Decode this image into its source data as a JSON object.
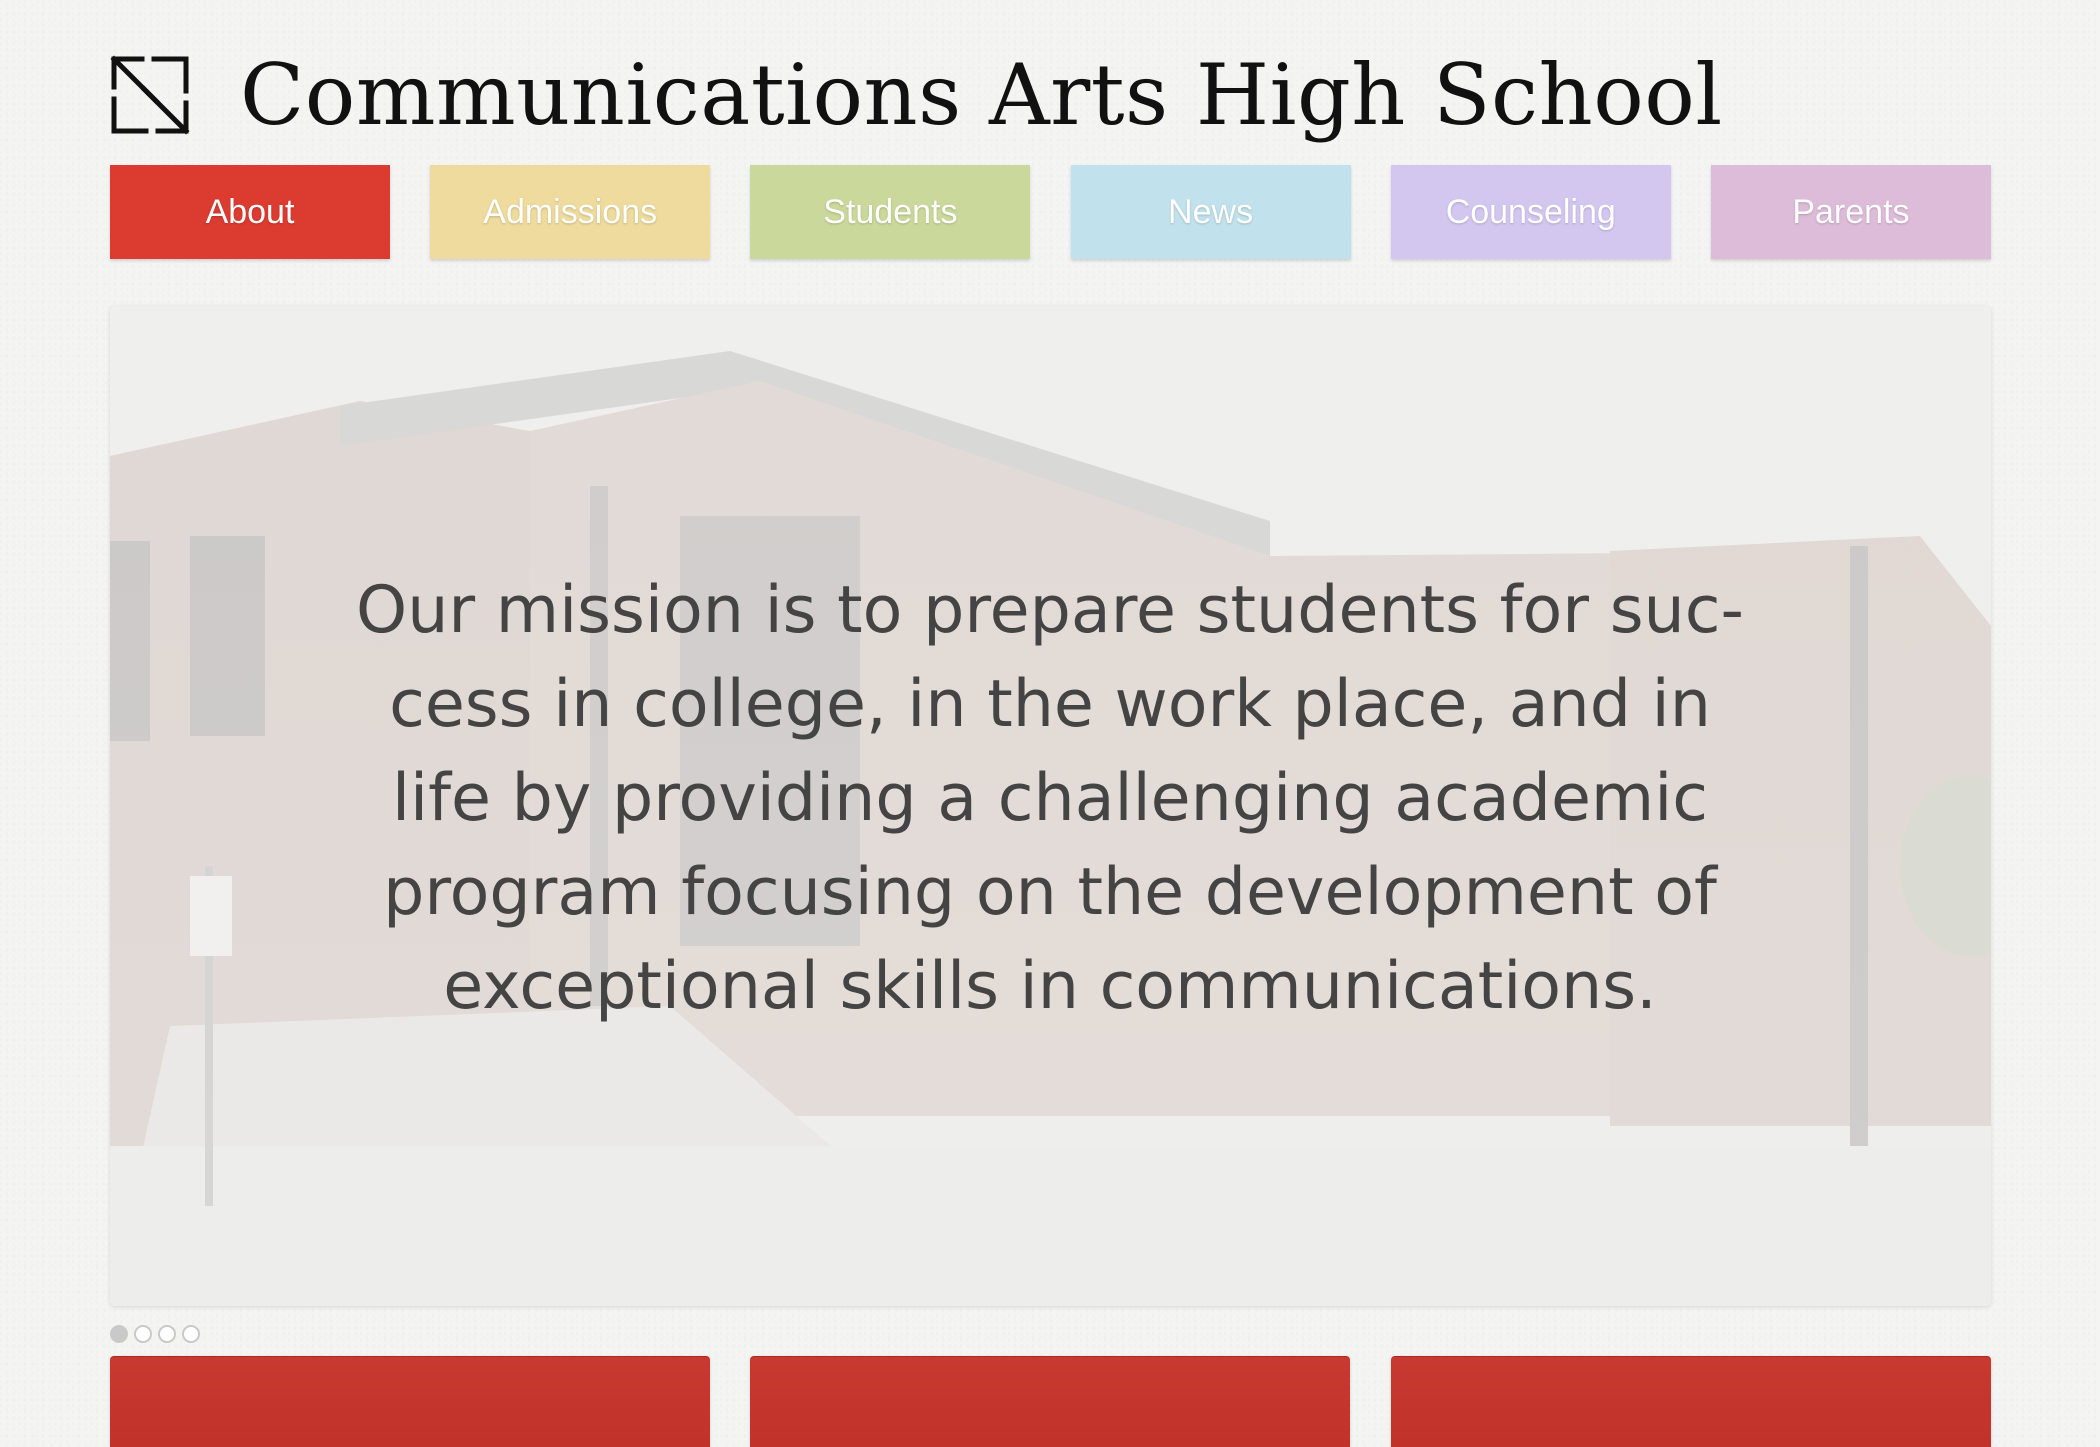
{
  "site": {
    "title": "Communications Arts High School",
    "logo_icon": "diagonal-arrows-logo-icon"
  },
  "nav": {
    "items": [
      {
        "label": "About",
        "color": "#dc3b30",
        "active": true
      },
      {
        "label": "Admissions",
        "color": "#eedb9d",
        "active": false
      },
      {
        "label": "Students",
        "color": "#cad99b",
        "active": false
      },
      {
        "label": "News",
        "color": "#c1e2ec",
        "active": false
      },
      {
        "label": "Counseling",
        "color": "#d3c7f0",
        "active": false
      },
      {
        "label": "Parents",
        "color": "#ddbcd9",
        "active": false
      }
    ]
  },
  "hero": {
    "mission": "Our mission is to prepare students for suc-cess in college, in the work place, and in life by providing a challenging academic program focusing on the development of exceptional skills in communications.",
    "background_description": "school-building-photo"
  },
  "carousel": {
    "slide_count": 4,
    "active_index": 0
  },
  "cards": {
    "count": 3,
    "color": "#c23329"
  }
}
